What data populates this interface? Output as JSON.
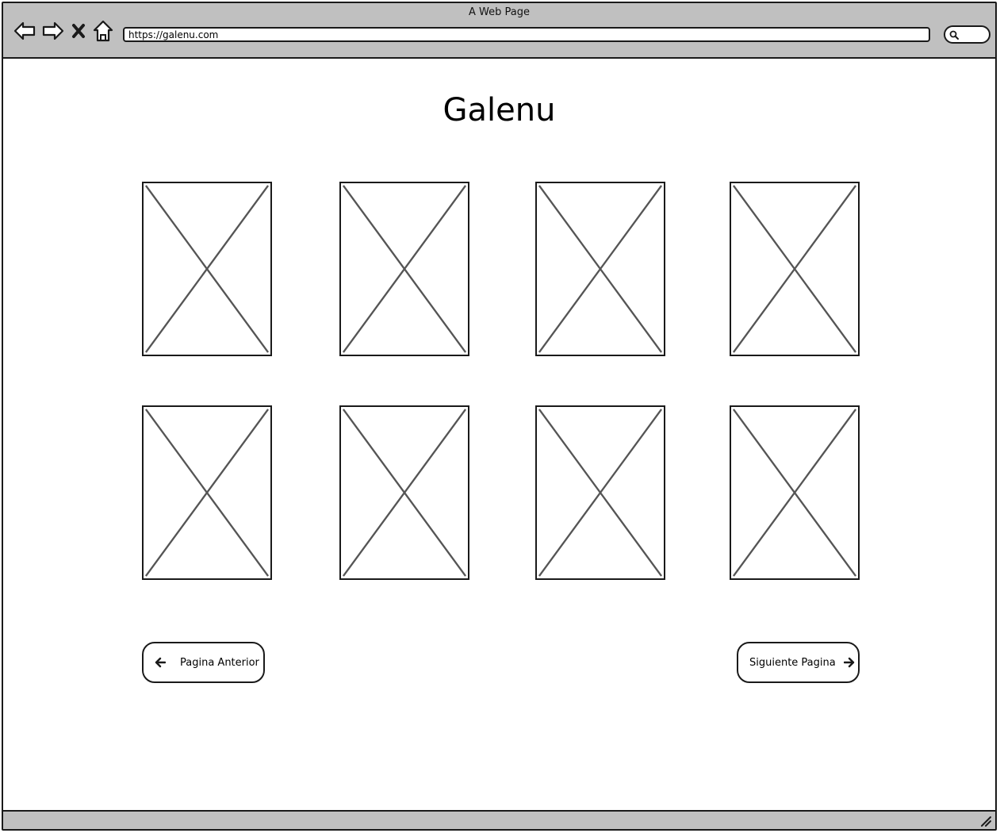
{
  "window": {
    "title": "A Web Page"
  },
  "toolbar": {
    "back_icon": "arrow-left-outline-icon",
    "forward_icon": "arrow-right-outline-icon",
    "stop_icon": "close-x-icon",
    "home_icon": "home-icon",
    "search_icon": "magnifier-icon"
  },
  "address": {
    "url": "https://galenu.com"
  },
  "main": {
    "title": "Galenu",
    "images": [
      {
        "kind": "image-placeholder"
      },
      {
        "kind": "image-placeholder"
      },
      {
        "kind": "image-placeholder"
      },
      {
        "kind": "image-placeholder"
      },
      {
        "kind": "image-placeholder"
      },
      {
        "kind": "image-placeholder"
      },
      {
        "kind": "image-placeholder"
      },
      {
        "kind": "image-placeholder"
      }
    ]
  },
  "pagination": {
    "prev_label": "Pagina Anterior",
    "next_label": "Siguiente Pagina"
  },
  "colors": {
    "chrome": "#c0c0c0",
    "border": "#1a1a1a",
    "placeholder_cross": "#555555"
  }
}
